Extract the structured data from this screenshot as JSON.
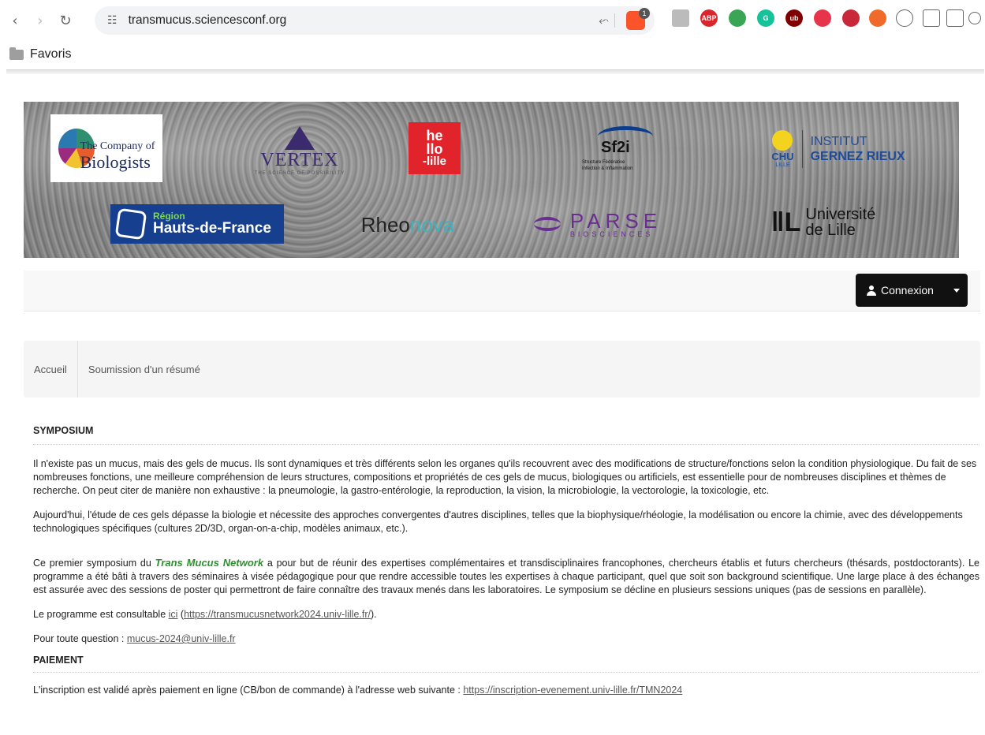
{
  "browser": {
    "url": "transmucus.sciencesconf.org",
    "brave_count": "1",
    "bookmarks_folder": "Favoris"
  },
  "banner": {
    "cob": {
      "line1": "The Company of",
      "line2": "Biologists"
    },
    "vertex": {
      "name": "VERTEX",
      "tag": "THE SCIENCE OF POSSIBILITY"
    },
    "hello": {
      "line1": "he",
      "line2": "llo",
      "line3": "-lille"
    },
    "sf2i": {
      "name": "Sf2i",
      "sub1": "Structure Fédérative",
      "sub2": "Infection & Inflammation"
    },
    "chu": {
      "left": "CHU",
      "left_small": "LILLE",
      "line1": "INSTITUT",
      "line2": "GERNEZ RIEUX"
    },
    "region": {
      "line1": "Région",
      "line2": "Hauts-de-France"
    },
    "rheonova": {
      "part1": "Rheo",
      "part2": "nova"
    },
    "parse": {
      "name": "PARSE",
      "sub": "BIOSCIENCES"
    },
    "ulille": {
      "line1": "Université",
      "line2": "de Lille"
    }
  },
  "nav": {
    "login_label": "Connexion"
  },
  "menu": {
    "items": [
      "Accueil",
      "Soumission d'un résumé"
    ]
  },
  "content": {
    "heading1": "SYMPOSIUM",
    "para1": "Il n'existe pas un mucus, mais des gels de mucus. Ils sont dynamiques et très différents selon les organes qu'ils recouvrent avec des modifications de structure/fonctions selon la condition physiologique. Du fait de ses nombreuses fonctions, une meilleure compréhension de leurs structures, compositions et propriétés de ces gels de mucus, biologiques ou artificiels, est essentielle pour de nombreuses disciplines et thèmes de recherche. On peut citer de manière non exhaustive : la pneumologie, la gastro-entérologie, la reproduction, la vision, la microbiologie, la vectorologie, la toxicologie, etc.",
    "para2": "Aujourd'hui, l'étude de ces gels dépasse la biologie et nécessite des approches convergentes d'autres disciplines, telles que la biophysique/rhéologie, la modélisation ou encore la chimie, avec des développements technologiques spécifiques (cultures 2D/3D, organ-on-a-chip, modèles animaux, etc.).",
    "para3_a": "Ce premier symposium du ",
    "para3_network": "Trans Mucus Network",
    "para3_b": " a pour but de réunir des expertises complémentaires et transdisciplinaires francophones, chercheurs établis et futurs chercheurs (thésards, postdoctorants). Le programme a été bâti à travers des séminaires à visée pédagogique pour que rendre accessible toutes les expertises à chaque participant, quel que soit son background scientifique. Une large place à des échanges est assurée avec des sessions de poster qui permettront de faire connaître des travaux menés dans les laboratoires. Le symposium se décline en plusieurs sessions uniques (pas de sessions en parallèle).",
    "program_a": "Le programme est consultable ",
    "program_link": "ici",
    "program_b": " (",
    "program_url": "https://transmucusnetwork2024.univ-lille.fr/",
    "program_c": ").",
    "question_a": "Pour toute question : ",
    "question_email": "mucus-2024@univ-lille.fr",
    "heading2": "PAIEMENT",
    "payment_a": "L'inscription est validé après paiement en ligne (CB/bon de commande) à l'adresse web suivante : ",
    "payment_url": "https://inscription-evenement.univ-lille.fr/TMN2024"
  },
  "colors": {
    "accent_green": "#2d8f2f",
    "login_bg": "#111111"
  }
}
